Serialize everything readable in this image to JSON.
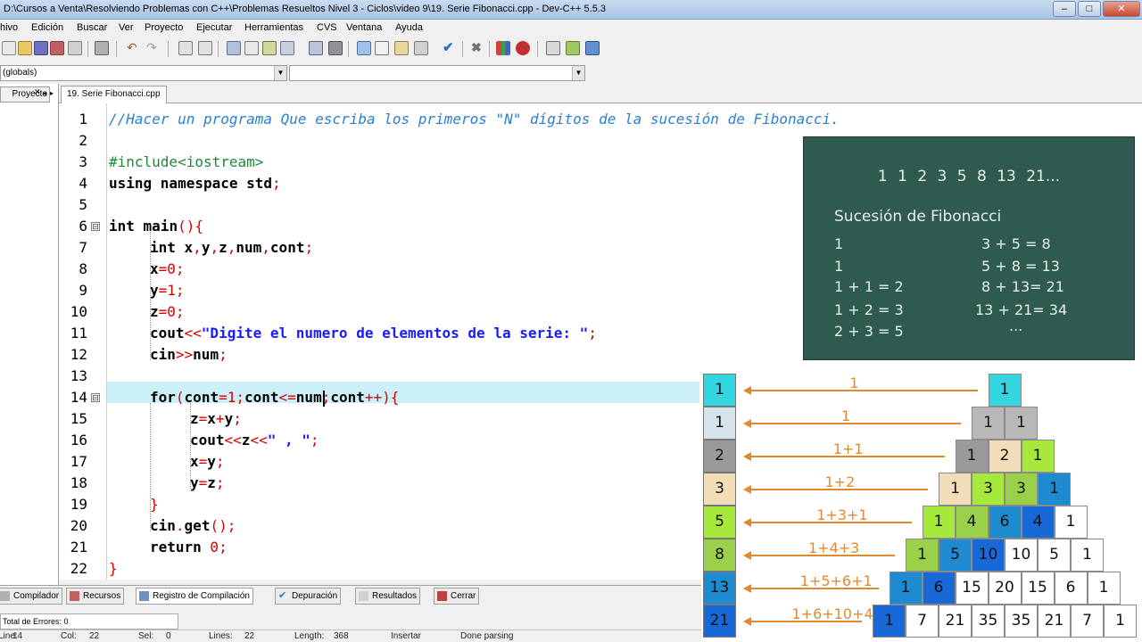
{
  "window": {
    "title": "D:\\Cursos a Venta\\Resolviendo Problemas con C++\\Problemas Resueltos Nivel 3 - Ciclos\\video 9\\19. Serie Fibonacci.cpp - Dev-C++ 5.5.3",
    "min_label": "–",
    "max_label": "□",
    "close_label": "✕"
  },
  "menu": [
    "hivo",
    "Edición",
    "Buscar",
    "Ver",
    "Proyecto",
    "Ejecutar",
    "Herramientas",
    "CVS",
    "Ventana",
    "Ayuda"
  ],
  "toolbar_icons": [
    "new-file-icon",
    "open-icon",
    "save-icon",
    "save-all-icon",
    "close-icon",
    "print-icon",
    "undo-icon",
    "redo-icon",
    "find-icon",
    "replace-icon",
    "goto-icon",
    "compile-icon",
    "run-icon",
    "compile-run-icon",
    "rebuild-icon",
    "check-icon",
    "stop-icon",
    "chart-icon",
    "debug-icon",
    "project-add-icon",
    "project-remove-icon",
    "options-icon"
  ],
  "combos": {
    "scope": "(globals)",
    "members": ""
  },
  "project_pane": {
    "tab_label": "Proyecto"
  },
  "editor": {
    "tab_label": "19. Serie Fibonacci.cpp",
    "line_numbers": [
      "1",
      "2",
      "3",
      "4",
      "5",
      "6",
      "7",
      "8",
      "9",
      "10",
      "11",
      "12",
      "13",
      "14",
      "15",
      "16",
      "17",
      "18",
      "19",
      "20",
      "21",
      "22"
    ],
    "current_line": 14
  },
  "code": {
    "l1": "//Hacer un programa Que escriba los primeros \"N\" dígitos de la sucesión de Fibonacci.",
    "l3": "#include<iostream>",
    "l4a": "using namespace std",
    "l4b": ";",
    "l6a": "int",
    "l6b": " main",
    "l6c": "(){",
    "l7a": "int",
    "l7b": " x",
    "l7c": ",",
    "l7d": "y",
    "l7e": ",",
    "l7f": "z",
    "l7g": ",",
    "l7h": "num",
    "l7i": ",",
    "l7j": "cont",
    "l7k": ";",
    "l8a": "x",
    "l8b": "=",
    "l8c": "0",
    "l8d": ";",
    "l9a": "y",
    "l9b": "=",
    "l9c": "1",
    "l9d": ";",
    "l10a": "z",
    "l10b": "=",
    "l10c": "0",
    "l10d": ";",
    "l11a": "cout",
    "l11b": "<<",
    "l11c": "\"Digite el numero de elementos de la serie: \"",
    "l11d": ";",
    "l12a": "cin",
    "l12b": ">>",
    "l12c": "num",
    "l12d": ";",
    "l14a": "for",
    "l14b": "(",
    "l14c": "cont",
    "l14d": "=",
    "l14e": "1",
    "l14f": ";",
    "l14g": "cont",
    "l14h": "<=",
    "l14i": "num",
    "l14j": ";",
    "l14k": "cont",
    "l14l": "++",
    "l14m": "){",
    "l15a": "z",
    "l15b": "=",
    "l15c": "x",
    "l15d": "+",
    "l15e": "y",
    "l15f": ";",
    "l16a": "cout",
    "l16b": "<<",
    "l16c": "z",
    "l16d": "<<",
    "l16e": "\" , \"",
    "l16f": ";",
    "l17a": "x",
    "l17b": "=",
    "l17c": "y",
    "l17d": ";",
    "l18a": "y",
    "l18b": "=",
    "l18c": "z",
    "l18d": ";",
    "l19": "}",
    "l20a": "cin",
    "l20b": ".",
    "l20c": "get",
    "l20d": "();",
    "l21a": "return",
    "l21b": " 0",
    "l21c": ";",
    "l22": "}"
  },
  "chalkboard": {
    "sequence": "1 1 2 3 5 8 13 21...",
    "heading": "Sucesión de Fibonacci",
    "left": [
      "1",
      "1",
      "1 + 1 = 2",
      "1 + 2 = 3",
      "2 + 3 = 5"
    ],
    "right": [
      "3 + 5 = 8",
      "5 + 8 = 13",
      "8 + 13= 21",
      "13 + 21= 34",
      "..."
    ]
  },
  "pyramid": {
    "left_values": [
      "1",
      "1",
      "2",
      "3",
      "5",
      "8",
      "13",
      "21"
    ],
    "left_colors": [
      "#33d6e0",
      "#d4e4e8",
      "#9a9a9a",
      "#f2ddb8",
      "#a6e83c",
      "#9bd04a",
      "#1e8bd0",
      "#1868d8"
    ],
    "sums": [
      "1",
      "1",
      "1+1",
      "1+2",
      "1+3+1",
      "1+4+3",
      "1+5+6+1",
      "1+6+10+4"
    ],
    "rows": [
      [
        "1"
      ],
      [
        "1",
        "1"
      ],
      [
        "1",
        "2",
        "1"
      ],
      [
        "1",
        "3",
        "3",
        "1"
      ],
      [
        "1",
        "4",
        "6",
        "4",
        "1"
      ],
      [
        "1",
        "5",
        "10",
        "10",
        "5",
        "1"
      ],
      [
        "1",
        "6",
        "15",
        "20",
        "15",
        "6",
        "1"
      ],
      [
        "1",
        "7",
        "21",
        "35",
        "35",
        "21",
        "7",
        "1"
      ]
    ],
    "row_colors": [
      [
        "#33d6e0"
      ],
      [
        "#b8b8b8",
        "#b8b8b8"
      ],
      [
        "#9a9a9a",
        "#f2ddb8",
        "#a6e83c"
      ],
      [
        "#f2ddb8",
        "#a6e83c",
        "#9bd04a",
        "#1e8bd0"
      ],
      [
        "#a6e83c",
        "#9bd04a",
        "#1e8bd0",
        "#1868d8",
        "#ffffff"
      ],
      [
        "#9bd04a",
        "#1e8bd0",
        "#1868d8",
        "#ffffff",
        "#ffffff",
        "#ffffff"
      ],
      [
        "#1e8bd0",
        "#1868d8",
        "#ffffff",
        "#ffffff",
        "#ffffff",
        "#ffffff",
        "#ffffff"
      ],
      [
        "#1868d8",
        "#ffffff",
        "#ffffff",
        "#ffffff",
        "#ffffff",
        "#ffffff",
        "#ffffff",
        "#ffffff"
      ]
    ],
    "accent": "#e08a30"
  },
  "bottom_tabs": [
    "Compilador",
    "Recursos",
    "Registro de Compilación",
    "Depuración",
    "Resultados",
    "Cerrar"
  ],
  "bottom_tab_icons": [
    "compiler-icon",
    "resources-icon",
    "compile-log-icon",
    "debug-icon",
    "results-icon",
    "close-icon"
  ],
  "errors_label": "Total de Errores: 0",
  "status": {
    "line_label": "Line:",
    "line_value": "14",
    "col_label": "Col:",
    "col_value": "22",
    "sel_label": "Sel:",
    "sel_value": "0",
    "lines_label": "Lines:",
    "lines_value": "22",
    "length_label": "Length:",
    "length_value": "368",
    "mode": "Insertar",
    "message": "Done parsing"
  }
}
